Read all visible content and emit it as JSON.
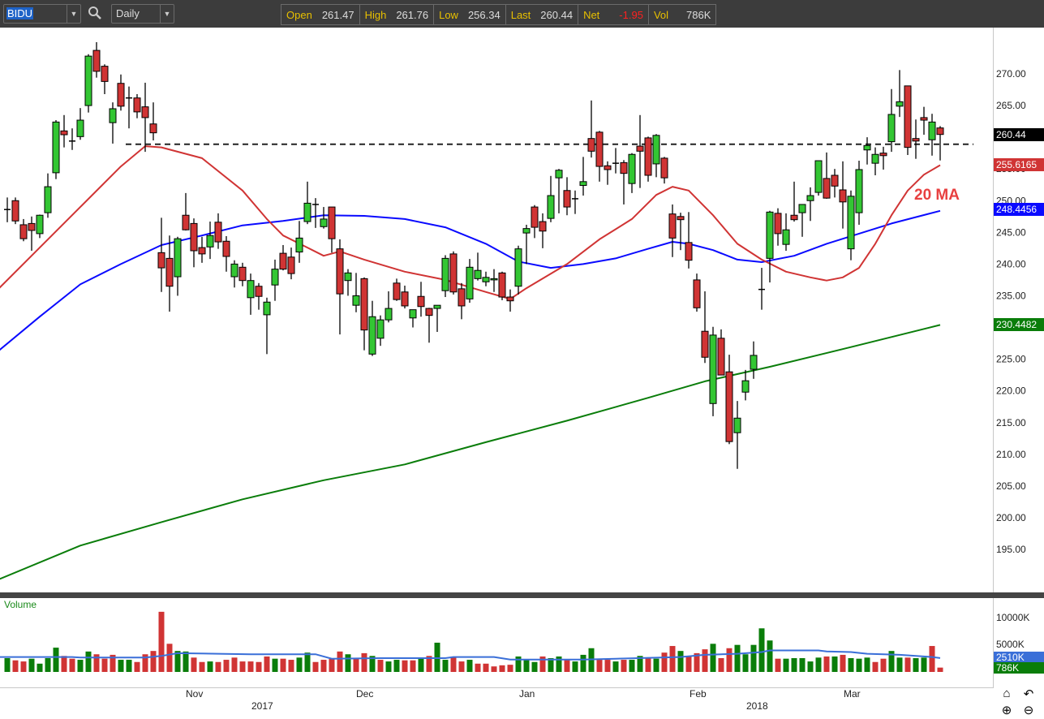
{
  "toolbar": {
    "symbol": "BIDU",
    "period": "Daily",
    "quote": [
      {
        "label": "Open",
        "value": "261.47"
      },
      {
        "label": "High",
        "value": "261.76"
      },
      {
        "label": "Low",
        "value": "256.34"
      },
      {
        "label": "Last",
        "value": "260.44"
      },
      {
        "label": "Net",
        "value": "-1.95"
      },
      {
        "label": "Vol",
        "value": "786K"
      }
    ]
  },
  "colors": {
    "up": "#33c633",
    "down": "#d03434",
    "vol_up": "#0a7d0a",
    "vol_down": "#d03434",
    "ma20": "#d03434",
    "ma50": "#0a0aff",
    "ma200": "#0a7d0a",
    "vol_ma": "#3a6fd8"
  },
  "price_axis": {
    "ticks": [
      "270.00",
      "265.00",
      "260.00",
      "255.00",
      "250.00",
      "245.00",
      "240.00",
      "235.00",
      "230.00",
      "225.00",
      "220.00",
      "215.00",
      "210.00",
      "205.00",
      "200.00",
      "195.00"
    ],
    "badges": {
      "last": "260.44",
      "ma20": "255.6165",
      "ma50": "248.4456",
      "ma200": "230.4482"
    }
  },
  "annotation": "20 MA",
  "volume_pane": {
    "label": "Volume",
    "ticks": [
      "10000K",
      "5000K"
    ],
    "badges": {
      "ma": "2510K",
      "last": "786K"
    }
  },
  "x_axis": {
    "months": [
      "Nov",
      "Dec",
      "Jan",
      "Feb",
      "Mar"
    ],
    "years": [
      "2017",
      "2018"
    ]
  },
  "chart_data": {
    "type": "candlestick",
    "symbol": "BIDU",
    "interval": "Daily",
    "ylim": [
      190,
      275
    ],
    "resistance_level": 258.9,
    "ohlc": [
      [
        248.6,
        250.5,
        246.6,
        248.6
      ],
      [
        250.0,
        250.5,
        246.3,
        246.8
      ],
      [
        246.2,
        247.1,
        243.6,
        244.0
      ],
      [
        246.4,
        247.5,
        242.1,
        245.3
      ],
      [
        244.8,
        247.8,
        244.1,
        247.7
      ],
      [
        248.1,
        254.3,
        247.3,
        252.2
      ],
      [
        254.4,
        262.7,
        253.4,
        262.4
      ],
      [
        261.0,
        263.5,
        258.4,
        260.4
      ],
      [
        259.4,
        261.4,
        258.0,
        259.4
      ],
      [
        260.1,
        264.6,
        259.6,
        262.7
      ],
      [
        265.0,
        273.1,
        263.9,
        272.8
      ],
      [
        273.7,
        275.0,
        269.4,
        270.4
      ],
      [
        271.2,
        271.5,
        266.8,
        268.8
      ],
      [
        262.3,
        265.5,
        259.0,
        264.5
      ],
      [
        268.5,
        269.9,
        264.2,
        264.9
      ],
      [
        266.2,
        268.0,
        261.4,
        266.2
      ],
      [
        266.2,
        266.8,
        263.0,
        264.0
      ],
      [
        264.8,
        268.6,
        257.7,
        263.1
      ],
      [
        262.1,
        265.5,
        259.5,
        260.7
      ],
      [
        241.8,
        247.3,
        235.6,
        239.4
      ],
      [
        240.9,
        244.5,
        232.5,
        236.5
      ],
      [
        238.0,
        244.3,
        235.0,
        244.0
      ],
      [
        247.7,
        251.2,
        245.3,
        245.4
      ],
      [
        246.4,
        247.2,
        239.5,
        242.1
      ],
      [
        242.6,
        244.3,
        240.2,
        241.6
      ],
      [
        242.7,
        246.7,
        240.8,
        244.5
      ],
      [
        246.6,
        248.0,
        242.4,
        243.5
      ],
      [
        243.6,
        244.4,
        238.8,
        241.2
      ],
      [
        238.0,
        240.6,
        236.3,
        240.0
      ],
      [
        239.5,
        240.2,
        236.5,
        237.4
      ],
      [
        234.7,
        238.5,
        232.0,
        237.4
      ],
      [
        236.5,
        237.0,
        232.8,
        234.9
      ],
      [
        232.0,
        234.7,
        225.8,
        234.0
      ],
      [
        236.7,
        240.7,
        234.2,
        239.2
      ],
      [
        241.7,
        243.0,
        239.0,
        239.2
      ],
      [
        241.1,
        242.6,
        237.6,
        238.5
      ],
      [
        241.9,
        246.8,
        240.2,
        244.1
      ],
      [
        246.7,
        253.0,
        246.3,
        249.6
      ],
      [
        249.4,
        250.4,
        245.7,
        249.4
      ],
      [
        245.9,
        249.0,
        245.6,
        247.1
      ],
      [
        249.0,
        249.0,
        241.8,
        244.0
      ],
      [
        242.4,
        243.9,
        228.9,
        235.3
      ],
      [
        237.4,
        239.2,
        235.0,
        238.6
      ],
      [
        233.5,
        238.6,
        232.4,
        235.0
      ],
      [
        237.7,
        237.9,
        226.4,
        229.6
      ],
      [
        225.8,
        234.2,
        225.5,
        231.7
      ],
      [
        228.3,
        231.9,
        227.1,
        231.2
      ],
      [
        231.2,
        235.7,
        230.8,
        233.0
      ],
      [
        237.0,
        237.7,
        234.2,
        234.4
      ],
      [
        235.6,
        236.6,
        233.0,
        233.4
      ],
      [
        231.5,
        232.8,
        230.0,
        232.8
      ],
      [
        234.9,
        237.2,
        231.7,
        233.3
      ],
      [
        233.0,
        233.1,
        227.6,
        231.9
      ],
      [
        233.0,
        233.5,
        229.3,
        233.5
      ],
      [
        235.8,
        241.4,
        234.8,
        240.9
      ],
      [
        241.6,
        242.0,
        235.2,
        235.6
      ],
      [
        236.1,
        237.0,
        231.3,
        233.4
      ],
      [
        234.5,
        240.8,
        233.9,
        239.5
      ],
      [
        237.7,
        241.8,
        237.4,
        239.0
      ],
      [
        237.2,
        238.8,
        236.5,
        237.9
      ],
      [
        237.5,
        239.2,
        235.6,
        237.7
      ],
      [
        238.6,
        238.8,
        234.3,
        234.8
      ],
      [
        234.8,
        236.0,
        232.5,
        234.2
      ],
      [
        236.5,
        242.9,
        235.2,
        242.4
      ],
      [
        244.9,
        246.2,
        240.0,
        245.6
      ],
      [
        249.0,
        249.3,
        244.1,
        245.8
      ],
      [
        246.7,
        248.0,
        242.5,
        245.2
      ],
      [
        247.2,
        253.9,
        246.6,
        250.8
      ],
      [
        253.6,
        255.0,
        248.0,
        254.8
      ],
      [
        251.6,
        253.7,
        247.7,
        249.0
      ],
      [
        250.3,
        251.6,
        247.9,
        250.3
      ],
      [
        252.4,
        256.9,
        250.8,
        253.0
      ],
      [
        259.8,
        265.8,
        256.8,
        257.8
      ],
      [
        260.8,
        261.0,
        253.0,
        255.4
      ],
      [
        255.5,
        256.2,
        252.5,
        254.9
      ],
      [
        255.9,
        258.3,
        254.3,
        255.9
      ],
      [
        256.0,
        256.4,
        249.4,
        254.3
      ],
      [
        252.7,
        257.5,
        251.2,
        257.3
      ],
      [
        258.6,
        263.5,
        252.0,
        257.8
      ],
      [
        259.9,
        260.1,
        253.0,
        254.0
      ],
      [
        255.8,
        260.5,
        253.7,
        260.3
      ],
      [
        256.7,
        256.9,
        252.7,
        253.6
      ],
      [
        247.9,
        249.4,
        241.1,
        244.1
      ],
      [
        247.5,
        248.1,
        242.2,
        247.0
      ],
      [
        243.4,
        248.2,
        239.3,
        240.6
      ],
      [
        237.5,
        238.5,
        232.5,
        233.1
      ],
      [
        229.4,
        235.7,
        224.4,
        225.3
      ],
      [
        218.0,
        230.1,
        216.0,
        228.8
      ],
      [
        228.3,
        229.7,
        222.5,
        222.5
      ],
      [
        223.0,
        225.7,
        211.6,
        212.0
      ],
      [
        213.4,
        218.4,
        207.7,
        215.7
      ],
      [
        219.8,
        223.3,
        218.5,
        221.6
      ],
      [
        223.4,
        227.8,
        221.9,
        225.6
      ],
      [
        236.0,
        239.4,
        232.8,
        236.0
      ],
      [
        240.9,
        248.4,
        237.1,
        248.2
      ],
      [
        248.0,
        248.8,
        242.9,
        244.8
      ],
      [
        243.1,
        248.0,
        242.1,
        245.4
      ],
      [
        247.7,
        253.0,
        246.7,
        247.0
      ],
      [
        248.1,
        249.4,
        244.3,
        249.4
      ],
      [
        250.0,
        252.1,
        246.8,
        250.8
      ],
      [
        251.3,
        256.3,
        250.8,
        256.3
      ],
      [
        253.5,
        257.6,
        250.3,
        250.4
      ],
      [
        254.0,
        255.0,
        250.5,
        252.3
      ],
      [
        251.7,
        256.2,
        245.6,
        249.8
      ],
      [
        242.4,
        251.6,
        240.6,
        250.7
      ],
      [
        248.1,
        256.3,
        246.2,
        254.9
      ],
      [
        258.0,
        260.0,
        255.7,
        258.7
      ],
      [
        255.9,
        258.4,
        254.0,
        257.3
      ],
      [
        257.5,
        258.5,
        254.9,
        257.1
      ],
      [
        259.3,
        267.6,
        257.7,
        263.6
      ],
      [
        264.9,
        270.6,
        263.2,
        265.6
      ],
      [
        268.1,
        268.1,
        257.2,
        258.4
      ],
      [
        259.8,
        262.8,
        256.6,
        259.4
      ],
      [
        263.1,
        264.8,
        260.4,
        262.7
      ],
      [
        259.6,
        263.7,
        257.1,
        262.4
      ],
      [
        261.47,
        261.76,
        256.34,
        260.44
      ]
    ],
    "ma20": [
      [
        -1,
        236.2
      ],
      [
        4,
        242.6
      ],
      [
        9,
        249.0
      ],
      [
        14,
        255.4
      ],
      [
        17,
        258.6
      ],
      [
        19,
        258.4
      ],
      [
        24,
        256.7
      ],
      [
        29,
        251.6
      ],
      [
        32,
        247.1
      ],
      [
        34,
        244.5
      ],
      [
        37,
        242.6
      ],
      [
        39,
        241.3
      ],
      [
        41,
        242.0
      ],
      [
        44,
        240.7
      ],
      [
        49,
        238.8
      ],
      [
        54,
        237.5
      ],
      [
        59,
        235.6
      ],
      [
        62,
        234.5
      ],
      [
        64,
        236.2
      ],
      [
        69,
        240.0
      ],
      [
        73,
        243.9
      ],
      [
        77,
        247.1
      ],
      [
        80,
        250.9
      ],
      [
        82,
        252.2
      ],
      [
        84,
        251.6
      ],
      [
        87,
        247.7
      ],
      [
        90,
        243.2
      ],
      [
        93,
        240.7
      ],
      [
        96,
        238.8
      ],
      [
        99,
        237.9
      ],
      [
        101,
        237.4
      ],
      [
        103,
        237.9
      ],
      [
        105,
        239.4
      ],
      [
        107,
        243.2
      ],
      [
        109,
        247.7
      ],
      [
        111,
        251.6
      ],
      [
        113,
        254.1
      ],
      [
        115,
        255.6
      ]
    ],
    "ma50": [
      [
        -1,
        226.4
      ],
      [
        4,
        231.7
      ],
      [
        9,
        236.8
      ],
      [
        14,
        240.0
      ],
      [
        19,
        243.0
      ],
      [
        24,
        244.5
      ],
      [
        29,
        246.1
      ],
      [
        34,
        246.8
      ],
      [
        39,
        247.7
      ],
      [
        44,
        247.6
      ],
      [
        49,
        247.1
      ],
      [
        54,
        245.8
      ],
      [
        59,
        243.2
      ],
      [
        63,
        240.4
      ],
      [
        67,
        239.4
      ],
      [
        71,
        240.0
      ],
      [
        75,
        240.9
      ],
      [
        79,
        242.4
      ],
      [
        82,
        243.5
      ],
      [
        84,
        243.2
      ],
      [
        87,
        242.2
      ],
      [
        90,
        240.7
      ],
      [
        93,
        240.3
      ],
      [
        97,
        241.3
      ],
      [
        101,
        243.2
      ],
      [
        105,
        244.8
      ],
      [
        109,
        246.4
      ],
      [
        115,
        248.4
      ]
    ],
    "ma200": [
      [
        -1,
        190.3
      ],
      [
        9,
        195.6
      ],
      [
        19,
        199.3
      ],
      [
        29,
        202.9
      ],
      [
        39,
        205.9
      ],
      [
        49,
        208.4
      ],
      [
        59,
        211.9
      ],
      [
        69,
        215.3
      ],
      [
        79,
        218.9
      ],
      [
        86,
        221.5
      ],
      [
        94,
        223.8
      ],
      [
        104,
        226.9
      ],
      [
        115,
        230.4
      ]
    ],
    "volume_k": [
      2500,
      2100,
      1900,
      2400,
      1500,
      2500,
      4400,
      2900,
      2400,
      2200,
      3700,
      3200,
      2400,
      3100,
      2200,
      2200,
      1800,
      3200,
      3800,
      10900,
      5100,
      3800,
      3700,
      2600,
      1800,
      1900,
      1800,
      2200,
      2600,
      1900,
      1900,
      1800,
      2800,
      2400,
      2400,
      2200,
      2600,
      3500,
      1800,
      2200,
      2400,
      3700,
      3200,
      2400,
      3400,
      2900,
      2200,
      1900,
      2200,
      2100,
      2100,
      2500,
      2900,
      5300,
      2200,
      2600,
      1900,
      2200,
      1500,
      1500,
      1000,
      1200,
      1300,
      2800,
      2200,
      1800,
      2800,
      2500,
      2800,
      2200,
      1900,
      3100,
      4300,
      2200,
      2200,
      1900,
      2200,
      2200,
      2900,
      2500,
      2400,
      3500,
      4700,
      3800,
      2900,
      3400,
      4100,
      5100,
      2500,
      4300,
      4900,
      3200,
      4900,
      7900,
      5700,
      2400,
      2400,
      2500,
      2500,
      1900,
      2600,
      2800,
      2800,
      3100,
      2500,
      2400,
      2600,
      1800,
      2400,
      3800,
      2600,
      2600,
      2500,
      2600,
      4700,
      786
    ],
    "volume_up": "GRRGGGGRRGGRRRGGRRRRRGGRRGRRRRRRRGRRGGRRRRGRRGRGGRRGRGGRRGRRRRRGGGRGGRGGGRRGRGGRGRRGRRRGRRGGGGGRGGGGGRGRGGGRRGGRGGRR",
    "volume_ma_k": [
      [
        -1,
        2700
      ],
      [
        8,
        2700
      ],
      [
        9,
        2600
      ],
      [
        17,
        2600
      ],
      [
        19,
        2900
      ],
      [
        21,
        3400
      ],
      [
        26,
        3300
      ],
      [
        30,
        3200
      ],
      [
        38,
        3200
      ],
      [
        40,
        2400
      ],
      [
        46,
        2500
      ],
      [
        54,
        2500
      ],
      [
        55,
        2700
      ],
      [
        60,
        2700
      ],
      [
        62,
        2250
      ],
      [
        71,
        2250
      ],
      [
        75,
        2400
      ],
      [
        83,
        2700
      ],
      [
        86,
        3100
      ],
      [
        90,
        3300
      ],
      [
        93,
        3600
      ],
      [
        94,
        3900
      ],
      [
        100,
        3900
      ],
      [
        101,
        3700
      ],
      [
        104,
        3600
      ],
      [
        106,
        3300
      ],
      [
        110,
        3100
      ],
      [
        114,
        2700
      ],
      [
        115,
        2510
      ]
    ],
    "volume_ylim_k": [
      0,
      10000
    ]
  }
}
